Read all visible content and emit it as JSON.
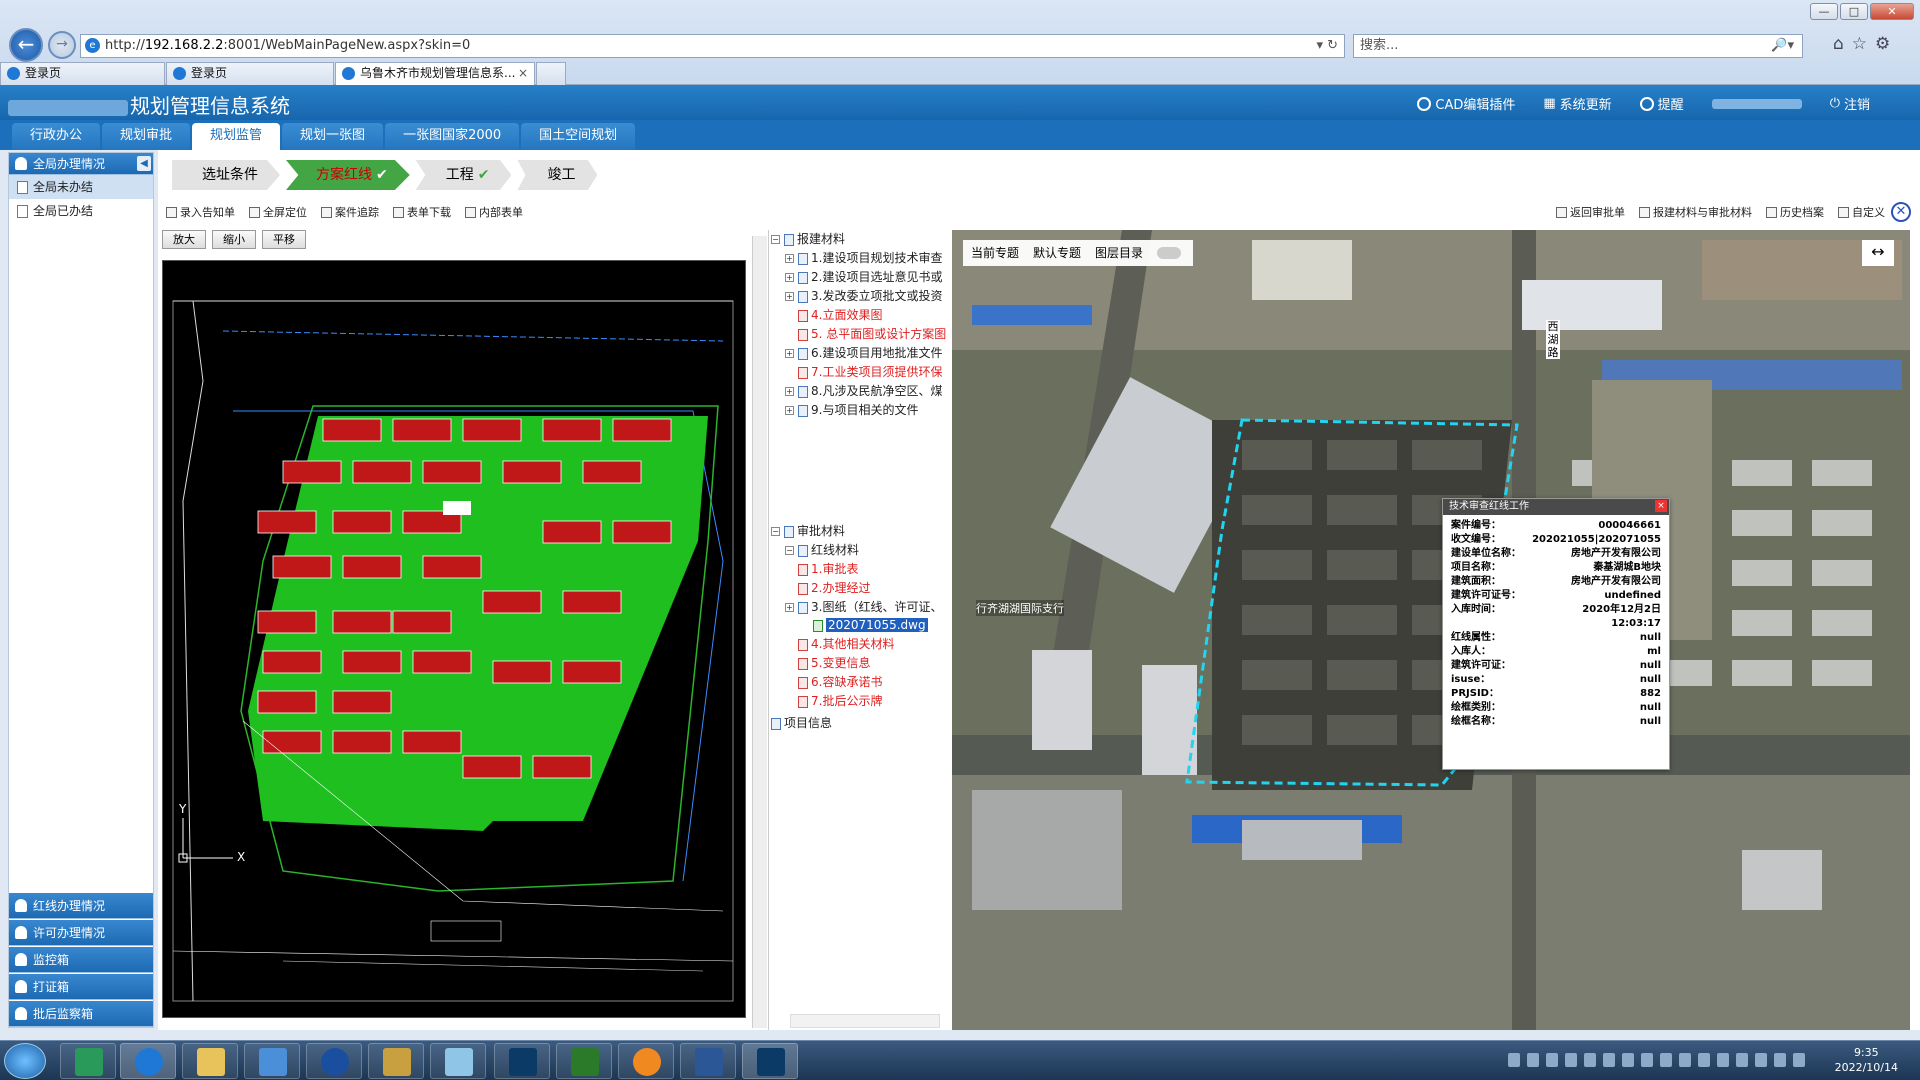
{
  "browser": {
    "window_controls": [
      "—",
      "□",
      "✕"
    ],
    "url_prefix": "http://",
    "url_host": "192.168.2.2",
    "url_rest": ":8001/WebMainPageNew.aspx?skin=0",
    "url_tools": "▾ ↻",
    "search_placeholder": "搜索...",
    "search_tools": "🔎▾",
    "tabs": [
      {
        "label": "登录页",
        "active": false
      },
      {
        "label": "登录页",
        "active": false
      },
      {
        "label": "乌鲁木齐市规划管理信息系...",
        "active": true
      }
    ]
  },
  "app": {
    "title": "规划管理信息系统",
    "header_menu": {
      "cad": "CAD编辑插件",
      "update": "系统更新",
      "remind": "提醒",
      "logout": "注销"
    },
    "module_tabs": [
      "行政办公",
      "规划审批",
      "规划监管",
      "规划一张图",
      "一张图国家2000",
      "国土空间规划"
    ],
    "active_module": 2
  },
  "sidebar": {
    "top_header": "全局办理情况",
    "items": [
      {
        "label": "全局未办结",
        "selected": true
      },
      {
        "label": "全局已办结",
        "selected": false
      }
    ],
    "bottom_headers": [
      "红线办理情况",
      "许可办理情况",
      "监控箱",
      "打证箱",
      "批后监察箱"
    ]
  },
  "steps": [
    {
      "label": "选址条件",
      "active": false,
      "check": false
    },
    {
      "label": "方案红线",
      "active": true,
      "check": true
    },
    {
      "label": "工程",
      "active": false,
      "check": true
    },
    {
      "label": "竣工",
      "active": false,
      "check": false
    }
  ],
  "toolbar": {
    "left": [
      "录入告知单",
      "全屏定位",
      "案件追踪",
      "表单下载",
      "内部表单"
    ],
    "right": [
      "返回审批单",
      "报建材料与审批材料",
      "历史档案",
      "自定义"
    ]
  },
  "cad": {
    "buttons": [
      "放大",
      "缩小",
      "平移"
    ],
    "axis_x": "X",
    "axis_y": "Y"
  },
  "tree": {
    "root1": "报建材料",
    "root1_items": [
      {
        "label": "1.建设项目规划技术审查",
        "red": false,
        "expand": true
      },
      {
        "label": "2.建设项目选址意见书或",
        "red": false,
        "expand": true
      },
      {
        "label": "3.发改委立项批文或投资",
        "red": false,
        "expand": true
      },
      {
        "label": "4.立面效果图",
        "red": true,
        "expand": false
      },
      {
        "label": "5. 总平面图或设计方案图",
        "red": true,
        "expand": false
      },
      {
        "label": "6.建设项目用地批准文件",
        "red": false,
        "expand": true
      },
      {
        "label": "7.工业类项目须提供环保",
        "red": true,
        "expand": false
      },
      {
        "label": "8.凡涉及民航净空区、煤",
        "red": false,
        "expand": true
      },
      {
        "label": "9.与项目相关的文件",
        "red": false,
        "expand": true
      }
    ],
    "root2": "审批材料",
    "sub2": "红线材料",
    "root2_items": [
      {
        "label": "1.审批表",
        "red": true,
        "expand": false
      },
      {
        "label": "2.办理经过",
        "red": true,
        "expand": false
      },
      {
        "label": "3.图纸（红线、许可证、",
        "red": false,
        "expand": true
      },
      {
        "label": "4.其他相关材料",
        "red": true,
        "expand": false
      },
      {
        "label": "5.变更信息",
        "red": true,
        "expand": false
      },
      {
        "label": "6.容缺承诺书",
        "red": true,
        "expand": false
      },
      {
        "label": "7.批后公示牌",
        "red": true,
        "expand": false
      }
    ],
    "file": "202071055.dwg",
    "root3": "项目信息"
  },
  "map": {
    "topic_label": "当前专题",
    "topic_value": "默认专题",
    "layer_label": "图层目录",
    "expand_icon": "↔",
    "road_label": "西湖路",
    "bank_label": "行齐湖湖国际支行",
    "popup": {
      "title": "技术审查红线工作",
      "rows": [
        {
          "k": "案件编号：",
          "v": "000046661"
        },
        {
          "k": "收文编号：",
          "v": "202021055|202071055"
        },
        {
          "k": "建设单位名称：",
          "v": "房地产开发有限公司"
        },
        {
          "k": "项目名称：",
          "v": "秦基湖城B地块"
        },
        {
          "k": "建筑面积：",
          "v": "房地产开发有限公司"
        },
        {
          "k": "建筑许可证号：",
          "v": "undefined"
        },
        {
          "k": "入库时间：",
          "v": "2020年12月2日 12:03:17"
        },
        {
          "k": "红线属性：",
          "v": "null"
        },
        {
          "k": "入库人：",
          "v": "ml"
        },
        {
          "k": "建筑许可证：",
          "v": "null"
        },
        {
          "k": "isuse：",
          "v": "null"
        },
        {
          "k": "PRJSID：",
          "v": "882"
        },
        {
          "k": "绘框类别：",
          "v": "null"
        },
        {
          "k": "绘框名称：",
          "v": "null"
        }
      ]
    }
  },
  "taskbar": {
    "time": "9:35",
    "date": "2022/10/14"
  },
  "colors": {
    "header_blue": "#1766ad",
    "step_green": "#43a544",
    "tree_red": "#e02020",
    "redline_cyan": "#22d4f0"
  }
}
